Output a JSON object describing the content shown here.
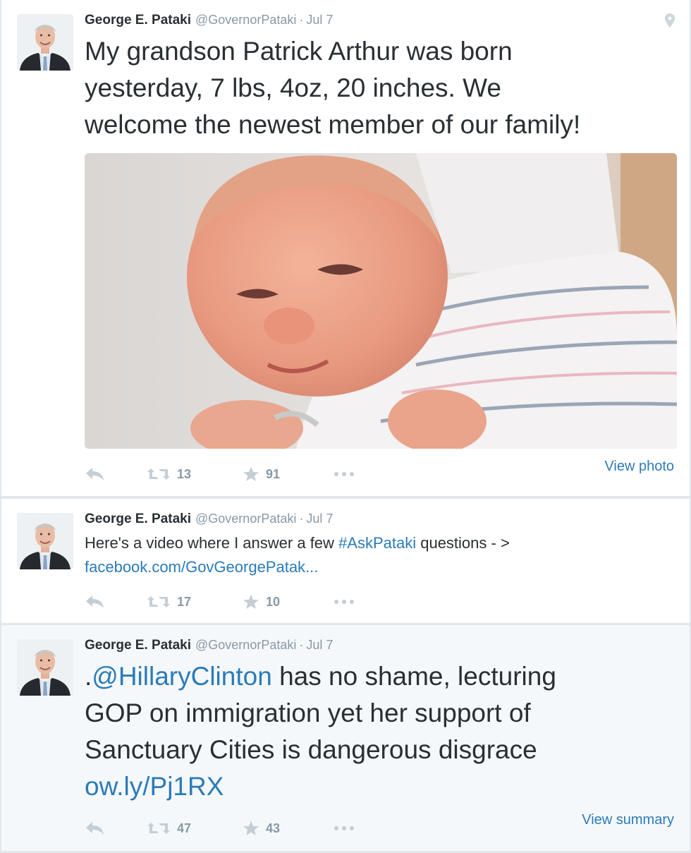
{
  "timeline": {
    "tweets": [
      {
        "author": "George E. Pataki",
        "handle": "@GovernorPataki",
        "separator": "·",
        "time": "Jul 7",
        "text_lines": [
          "My grandson Patrick Arthur was born",
          "yesterday, 7 lbs, 4oz, 20 inches. We",
          "welcome the newest member of our family!"
        ],
        "retweets": "13",
        "favorites": "91",
        "view_link": "View photo"
      },
      {
        "author": "George E. Pataki",
        "handle": "@GovernorPataki",
        "separator": "·",
        "time": "Jul 7",
        "text_pre": "Here's a video where I answer a few ",
        "hashtag": "#AskPataki",
        "text_post": " questions - >",
        "link": "facebook.com/GovGeorgePatak...",
        "retweets": "17",
        "favorites": "10"
      },
      {
        "author": "George E. Pataki",
        "handle": "@GovernorPataki",
        "separator": "·",
        "time": "Jul 7",
        "text_dot": ".",
        "mention": "@HillaryClinton",
        "text_line1_post": " has no shame, lecturing",
        "text_line2": "GOP on immigration yet her support of",
        "text_line3": "Sanctuary Cities is dangerous disgrace",
        "link": "ow.ly/Pj1RX",
        "retweets": "47",
        "favorites": "43",
        "view_link": "View summary"
      }
    ]
  },
  "icons": {
    "reply": "reply-icon",
    "retweet": "retweet-icon",
    "favorite": "star-icon",
    "more": "more-icon",
    "location": "location-pin-icon"
  },
  "colors": {
    "link": "#2b7bb9",
    "muted": "#8899a6",
    "text": "#292f33"
  }
}
